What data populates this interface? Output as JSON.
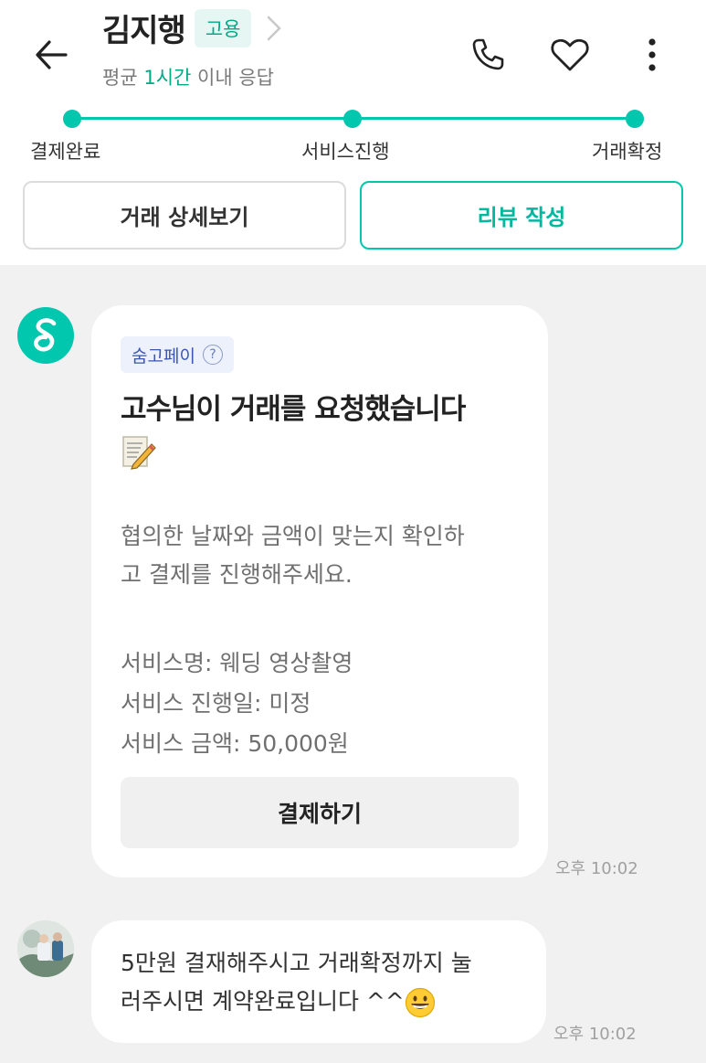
{
  "header": {
    "name": "김지행",
    "badge": "고용",
    "response_prefix": "평균 ",
    "response_highlight": "1시간",
    "response_suffix": " 이내 응답",
    "accent_color": "#00c7ae"
  },
  "progress": {
    "steps": [
      "결제완료",
      "서비스진행",
      "거래확정"
    ]
  },
  "actions": {
    "detail_label": "거래 상세보기",
    "review_label": "리뷰 작성"
  },
  "messages": {
    "card": {
      "chip_label": "숨고페이",
      "chip_help": "?",
      "title": "고수님이 거래를 요청했습니다",
      "body_line1": "협의한 날짜와 금액이 맞는지 확인하",
      "body_line2": "고 결제를 진행해주세요.",
      "service_name": "서비스명: 웨딩 영상촬영",
      "service_date": "서비스 진행일: 미정",
      "service_price": "서비스 금액: 50,000원",
      "pay_button": "결제하기",
      "time": "오후 10:02"
    },
    "user_message": {
      "line1": "5만원 결재해주시고 거래확정까지 눌",
      "line2": "러주시면 계약완료입니다 ^^",
      "time": "오후 10:02"
    }
  },
  "icons": [
    "back-arrow-icon",
    "chevron-right-icon",
    "phone-icon",
    "heart-icon",
    "more-vertical-icon",
    "soomgo-logo-icon",
    "memo-icon",
    "grinning-face-icon"
  ]
}
